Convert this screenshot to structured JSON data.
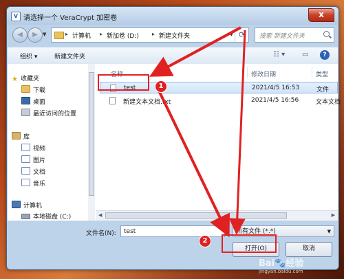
{
  "window": {
    "title": "请选择一个 VeraCrypt 加密卷",
    "close_glyph": "x"
  },
  "address_bar": {
    "crumbs": [
      "计算机",
      "新加卷 (D:)",
      "新建文件夹"
    ]
  },
  "search": {
    "placeholder": "搜索 新建文件夹"
  },
  "toolbar": {
    "organize": "组织 ▾",
    "new_folder": "新建文件夹"
  },
  "sidebar": {
    "favorites": {
      "label": "收藏夹",
      "items": [
        "下载",
        "桌面",
        "最近访问的位置"
      ]
    },
    "libraries": {
      "label": "库",
      "items": [
        "视频",
        "图片",
        "文档",
        "音乐"
      ]
    },
    "computer": {
      "label": "计算机",
      "items": [
        "本地磁盘 (C:)"
      ]
    }
  },
  "columns": {
    "name": "名称",
    "modified": "修改日期",
    "type": "类型"
  },
  "files": [
    {
      "name": "test",
      "modified": "2021/4/5 16:53",
      "type": "文件"
    },
    {
      "name": "新建文本文档.txt",
      "modified": "2021/4/5 16:56",
      "type": "文本文档"
    }
  ],
  "filename": {
    "label": "文件名(N):",
    "value": "test"
  },
  "filetype": {
    "value": "所有文件 (*.*)"
  },
  "buttons": {
    "open": "打开(O)",
    "cancel": "取消"
  },
  "annotations": {
    "badge1": "1",
    "badge2": "2",
    "color": "#e12121"
  },
  "watermark": {
    "line1": "Bai🐾经验",
    "line2": "jingyan.baidu.com"
  }
}
